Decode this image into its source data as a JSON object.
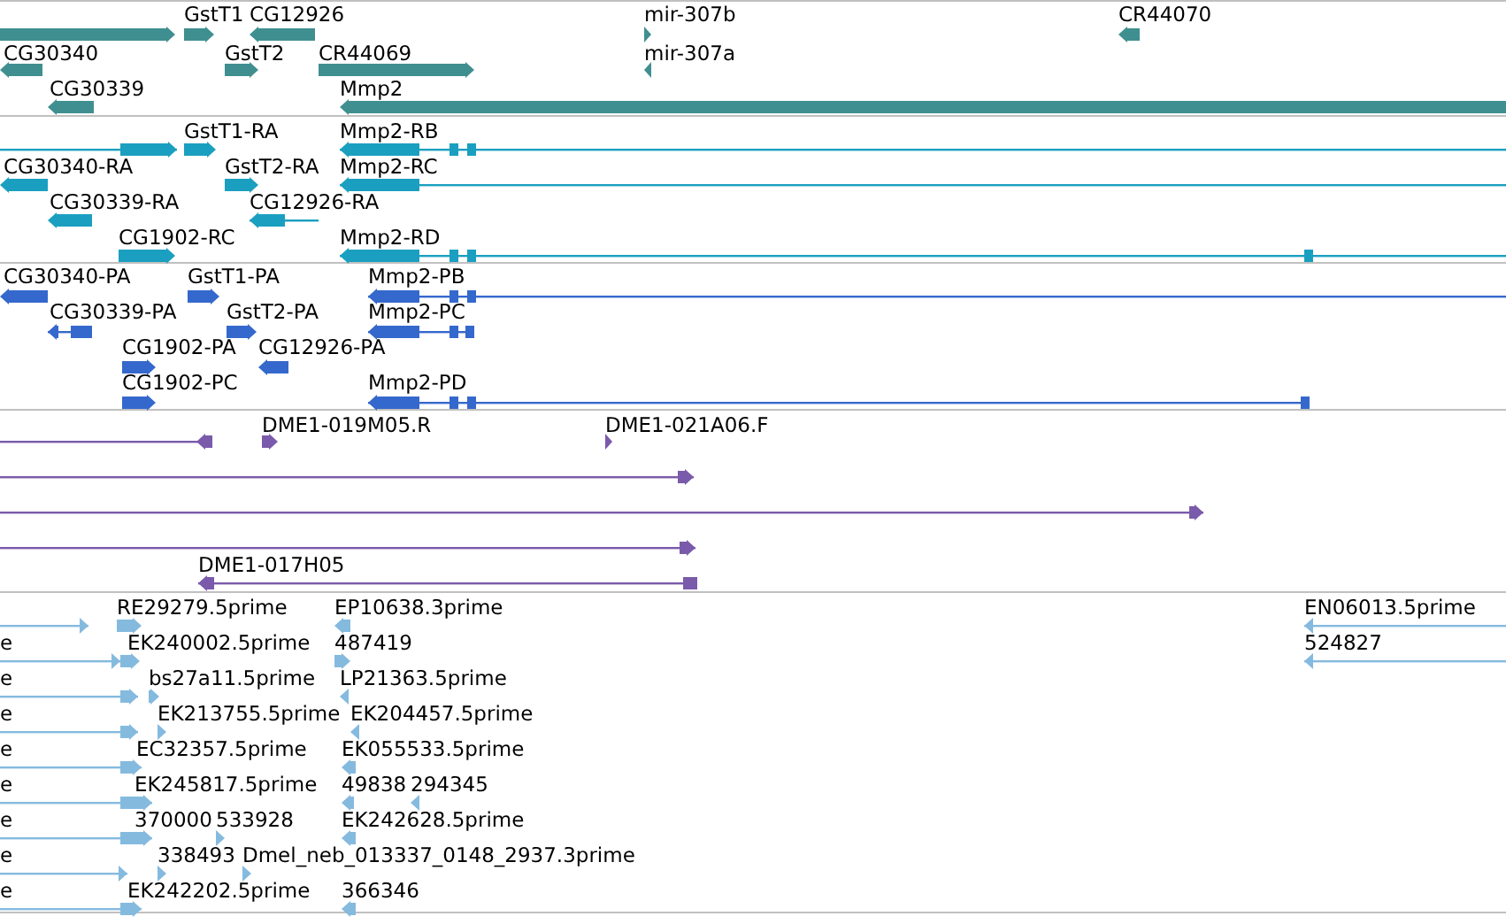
{
  "tracks": [
    {
      "kind": "gene",
      "features": [
        {
          "reverse": false
        },
        {
          "label": "GstT1",
          "reverse": false
        },
        {
          "label": "CG12926",
          "reverse": true
        },
        {
          "label": "mir-307b",
          "reverse": false
        },
        {
          "label": "CR44070",
          "reverse": true
        },
        {
          "label": "CG30340",
          "reverse": true
        },
        {
          "label": "GstT2",
          "reverse": false
        },
        {
          "label": "CR44069",
          "reverse": false
        },
        {
          "label": "mir-307a",
          "reverse": true
        },
        {
          "label": "CG30339",
          "reverse": true
        },
        {
          "label": "Mmp2",
          "reverse": true
        }
      ]
    },
    {
      "kind": "transcript",
      "features": [
        {
          "reverse": false
        },
        {
          "label": "GstT1-RA",
          "reverse": false
        },
        {
          "label": "Mmp2-RB",
          "reverse": true
        },
        {
          "label": "CG30340-RA",
          "reverse": true
        },
        {
          "label": "GstT2-RA",
          "reverse": false
        },
        {
          "label": "Mmp2-RC",
          "reverse": true
        },
        {
          "label": "CG30339-RA",
          "reverse": true
        },
        {
          "label": "CG12926-RA",
          "reverse": true
        },
        {
          "label": "CG1902-RC",
          "reverse": false
        },
        {
          "label": "Mmp2-RD",
          "reverse": true
        }
      ]
    },
    {
      "kind": "protein",
      "features": [
        {
          "label": "CG30340-PA",
          "reverse": true
        },
        {
          "label": "GstT1-PA",
          "reverse": false
        },
        {
          "label": "Mmp2-PB",
          "reverse": true
        },
        {
          "label": "CG30339-PA",
          "reverse": true
        },
        {
          "label": "GstT2-PA",
          "reverse": false
        },
        {
          "label": "Mmp2-PC",
          "reverse": true
        },
        {
          "label": "CG1902-PA",
          "reverse": false
        },
        {
          "label": "CG12926-PA",
          "reverse": true
        },
        {
          "label": "CG1902-PC",
          "reverse": false
        },
        {
          "label": "Mmp2-PD",
          "reverse": true
        }
      ]
    },
    {
      "kind": "clone",
      "features": [
        {
          "reverse": true
        },
        {
          "label": "DME1-019M05.R",
          "reverse": false
        },
        {
          "label": "DME1-021A06.F",
          "reverse": false
        },
        {
          "reverse": false
        },
        {
          "reverse": false
        },
        {
          "reverse": false
        },
        {
          "label": "DME1-017H05",
          "reverse": true
        }
      ]
    },
    {
      "kind": "est",
      "features": [
        {
          "reverse": false
        },
        {
          "label": "RE29279.5prime",
          "reverse": false
        },
        {
          "label": "EP10638.3prime",
          "reverse": true
        },
        {
          "label": "EN06013.5prime",
          "reverse": true
        },
        {
          "label": "e",
          "reverse": false
        },
        {
          "label": "EK240002.5prime",
          "reverse": false
        },
        {
          "label": "487419",
          "reverse": false
        },
        {
          "label": "524827",
          "reverse": true
        },
        {
          "label": "e",
          "reverse": false
        },
        {
          "label": "bs27a11.5prime",
          "reverse": false
        },
        {
          "label": "LP21363.5prime",
          "reverse": true
        },
        {
          "label": "e",
          "reverse": false
        },
        {
          "label": "EK213755.5prime",
          "reverse": false
        },
        {
          "label": "EK204457.5prime",
          "reverse": true
        },
        {
          "label": "e",
          "reverse": false
        },
        {
          "label": "EC32357.5prime"
        },
        {
          "label": "EK055533.5prime",
          "reverse": true
        },
        {
          "label": "e",
          "reverse": false
        },
        {
          "label": "EK245817.5prime"
        },
        {
          "label": "49838",
          "reverse": true
        },
        {
          "label": "294345",
          "reverse": true
        },
        {
          "label": "e",
          "reverse": false
        },
        {
          "label": "370000"
        },
        {
          "label": "533928",
          "reverse": false
        },
        {
          "label": "EK242628.5prime",
          "reverse": true
        },
        {
          "label": "e",
          "reverse": false
        },
        {
          "label": "338493",
          "reverse": false
        },
        {
          "label": "Dmel_neb_013337_0148_2937.3prime",
          "reverse": false
        },
        {
          "label": "e",
          "reverse": false
        },
        {
          "label": "EK242202.5prime"
        },
        {
          "label": "366346",
          "reverse": true
        }
      ]
    }
  ]
}
